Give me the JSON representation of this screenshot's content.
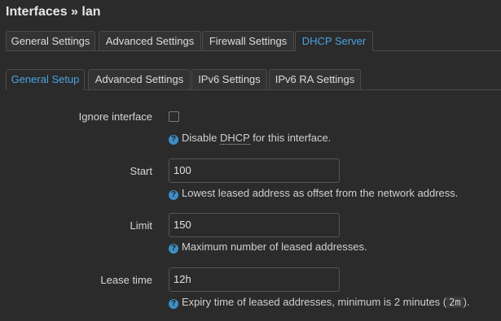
{
  "page": {
    "title": "Interfaces » lan"
  },
  "main_tabs": [
    {
      "label": "General Settings"
    },
    {
      "label": "Advanced Settings"
    },
    {
      "label": "Firewall Settings"
    },
    {
      "label": "DHCP Server",
      "active": true
    }
  ],
  "sub_tabs": [
    {
      "label": "General Setup",
      "active": true
    },
    {
      "label": "Advanced Settings"
    },
    {
      "label": "IPv6 Settings"
    },
    {
      "label": "IPv6 RA Settings"
    }
  ],
  "form": {
    "ignore_interface": {
      "label": "Ignore interface",
      "checked": false,
      "help_prefix": "Disable ",
      "help_abbr": "DHCP",
      "help_suffix": " for this interface."
    },
    "start": {
      "label": "Start",
      "value": "100",
      "help": "Lowest leased address as offset from the network address."
    },
    "limit": {
      "label": "Limit",
      "value": "150",
      "help": "Maximum number of leased addresses."
    },
    "lease_time": {
      "label": "Lease time",
      "value": "12h",
      "help_prefix": "Expiry time of leased addresses, minimum is 2 minutes (",
      "help_code": "2m",
      "help_suffix": ")."
    }
  },
  "icons": {
    "help": "question-circle-icon",
    "help_color": "#3e8fc7",
    "accent": "#4aa3df"
  }
}
